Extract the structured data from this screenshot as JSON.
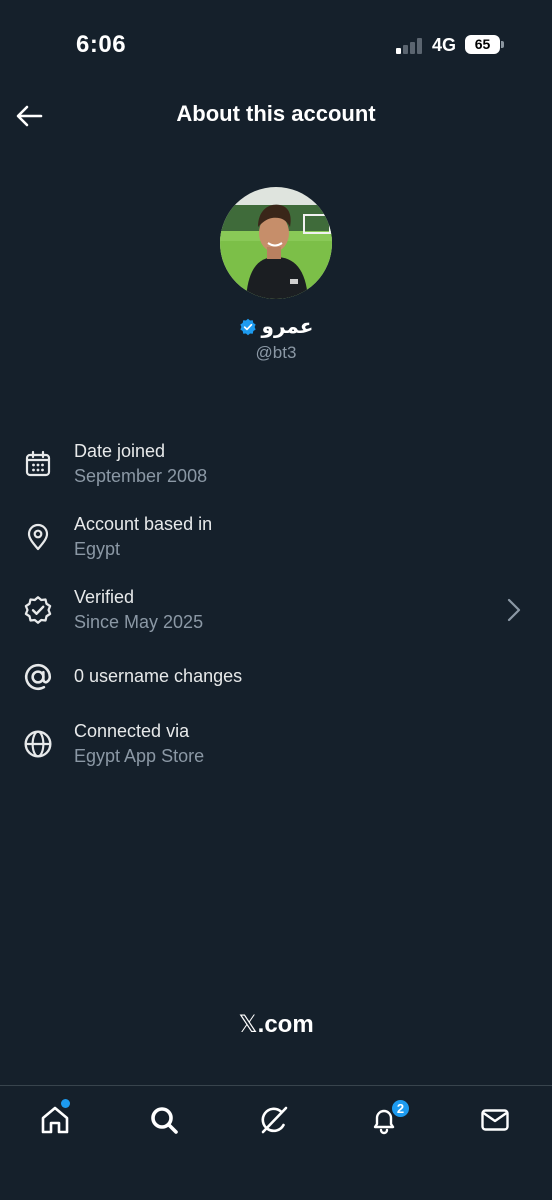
{
  "status_bar": {
    "time": "6:06",
    "network": "4G",
    "battery": "65"
  },
  "header": {
    "title": "About this account",
    "back_icon": "arrow-left-icon"
  },
  "profile": {
    "display_name": "عمرو",
    "handle": "@bt3",
    "verified": true,
    "verified_color": "#1d9bf0"
  },
  "info_items": [
    {
      "icon": "calendar-icon",
      "label": "Date joined",
      "value": "September 2008"
    },
    {
      "icon": "location-pin-icon",
      "label": "Account based in",
      "value": "Egypt"
    },
    {
      "icon": "verified-outline-icon",
      "label": "Verified",
      "value": "Since May 2025",
      "has_chevron": true
    },
    {
      "icon": "at-sign-icon",
      "label": "0 username changes"
    },
    {
      "icon": "globe-icon",
      "label": "Connected via",
      "value": "Egypt App Store"
    }
  ],
  "brand": {
    "x_glyph": "𝕏",
    "suffix": ".com"
  },
  "bottom_nav": {
    "items": [
      "home-icon",
      "search-icon",
      "grok-icon",
      "notifications-icon",
      "messages-icon"
    ],
    "notification_count": "2",
    "accent_color": "#1d9bf0"
  },
  "colors": {
    "background": "#15202b",
    "primary_text": "#e7e9ea",
    "secondary_text": "#8b98a5",
    "divider": "#38444d"
  }
}
